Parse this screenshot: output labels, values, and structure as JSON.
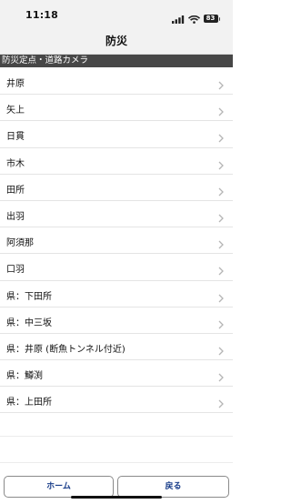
{
  "status_bar": {
    "time": "11:18",
    "battery": "83"
  },
  "nav": {
    "title": "防災"
  },
  "section": {
    "header": "防災定点・道路カメラ"
  },
  "items": [
    {
      "label": "井原"
    },
    {
      "label": "矢上"
    },
    {
      "label": "日貫"
    },
    {
      "label": "市木"
    },
    {
      "label": "田所"
    },
    {
      "label": "出羽"
    },
    {
      "label": "阿須那"
    },
    {
      "label": "口羽"
    },
    {
      "label": "県：下田所"
    },
    {
      "label": "県：中三坂"
    },
    {
      "label": "県：井原 (断魚トンネル付近)"
    },
    {
      "label": "県：鱒渕"
    },
    {
      "label": "県：上田所"
    }
  ],
  "footer": {
    "home_label": "ホーム",
    "back_label": "戻る"
  },
  "colors": {
    "section_header_bg": "#474747",
    "button_text": "#1a3e8a"
  }
}
